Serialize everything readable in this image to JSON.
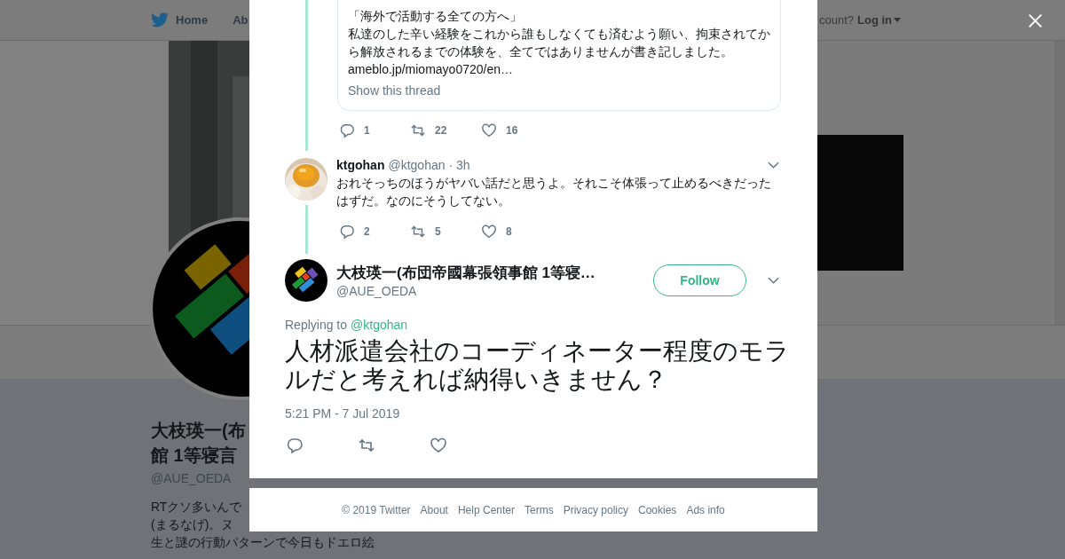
{
  "nav": {
    "items": [
      {
        "label": "Home",
        "kind": "home"
      },
      {
        "label": "Ab",
        "kind": "text"
      }
    ],
    "account_prompt": "count?",
    "login": "Log in"
  },
  "profile": {
    "name_lines": [
      "大枝瑛一(布",
      "館 1等寝言"
    ],
    "handle": "@AUE_OEDA",
    "bio_lines": [
      "RTクソ多いんで",
      "(まるなげ)。ヌ",
      "生と謎の行動パターンで今日もドエロ絵"
    ]
  },
  "modal": {
    "quoted": {
      "lines": [
        "「海外で活動する全ての方へ」",
        "私達のした辛い経験をこれから誰もしなくても済むよう願い、拘束されてから解放されるまでの体験を、全てではありませんが書き記しました。"
      ],
      "link": "ameblo.jp/miomayo0720/en…",
      "show_thread": "Show this thread",
      "actions": {
        "replies": "1",
        "retweets": "22",
        "likes": "16"
      }
    },
    "reply": {
      "name": "ktgohan",
      "handle": "@ktgohan",
      "time": "· 3h",
      "text": "おれそっちのほうがヤバい話だと思うよ。それこそ体張って止めるべきだったはずだ。なのにそうしてない。",
      "actions": {
        "replies": "2",
        "retweets": "5",
        "likes": "8"
      }
    },
    "tweet": {
      "name": "大枝瑛一(布団帝國幕張領事館 1等寝…",
      "handle": "@AUE_OEDA",
      "follow": "Follow",
      "replying_label": "Replying to",
      "replying_to": "@ktgohan",
      "text": "人材派遣会社のコーディネーター程度のモラルだと考えれば納得いきません？",
      "timestamp": "5:21 PM - 7 Jul 2019"
    }
  },
  "footer": [
    "© 2019 Twitter",
    "About",
    "Help Center",
    "Terms",
    "Privacy policy",
    "Cookies",
    "Ads info"
  ]
}
